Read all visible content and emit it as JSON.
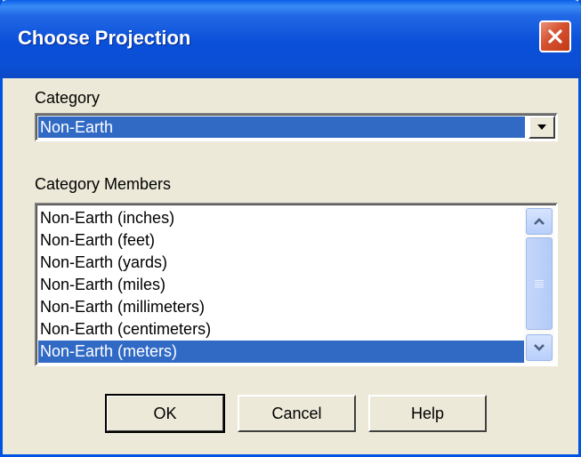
{
  "window": {
    "title": "Choose Projection"
  },
  "category": {
    "label": "Category",
    "selected": "Non-Earth"
  },
  "members": {
    "label": "Category Members",
    "items": [
      "Non-Earth (inches)",
      "Non-Earth (feet)",
      "Non-Earth (yards)",
      "Non-Earth (miles)",
      "Non-Earth (millimeters)",
      "Non-Earth (centimeters)",
      "Non-Earth (meters)"
    ],
    "selected_index": 6
  },
  "buttons": {
    "ok": "OK",
    "cancel": "Cancel",
    "help": "Help"
  },
  "icons": {
    "close": "close-icon",
    "dropdown": "chevron-down-icon",
    "scroll_up": "chevron-up-icon",
    "scroll_down": "chevron-down-icon",
    "grip": "grip-icon"
  },
  "colors": {
    "titlebar": "#0a4fd8",
    "selection": "#316ac5",
    "dialog_bg": "#ece9d8"
  }
}
